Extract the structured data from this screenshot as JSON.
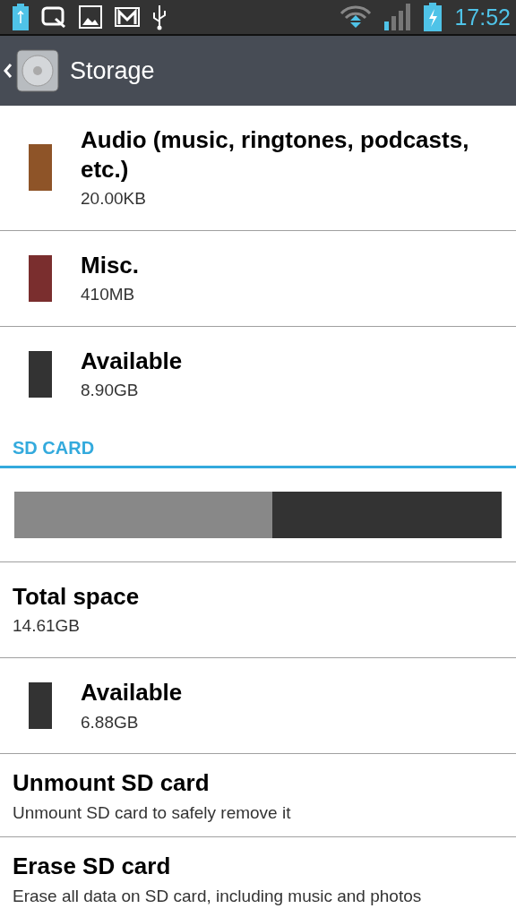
{
  "status_bar": {
    "time": "17:52"
  },
  "action_bar": {
    "title": "Storage"
  },
  "internal_items": [
    {
      "kind": "category",
      "title": "Audio (music, ringtones, podcasts, etc.)",
      "subtitle": "20.00KB",
      "color": "#8e5428"
    },
    {
      "kind": "category",
      "title": "Misc.",
      "subtitle": "410MB",
      "color": "#7a2e2e"
    },
    {
      "kind": "category",
      "title": "Available",
      "subtitle": "8.90GB",
      "color": "#333333"
    }
  ],
  "sd_card": {
    "header": "SD CARD",
    "usage_bar": {
      "level": 0.53
    },
    "items": [
      {
        "kind": "plain",
        "title": "Total space",
        "subtitle": "14.61GB"
      },
      {
        "kind": "category",
        "title": "Available",
        "subtitle": "6.88GB",
        "color": "#333333"
      },
      {
        "kind": "action",
        "title": "Unmount SD card",
        "subtitle": "Unmount SD card to safely remove it"
      },
      {
        "kind": "action",
        "title": "Erase SD card",
        "subtitle": "Erase all data on SD card, including music and photos"
      }
    ]
  }
}
